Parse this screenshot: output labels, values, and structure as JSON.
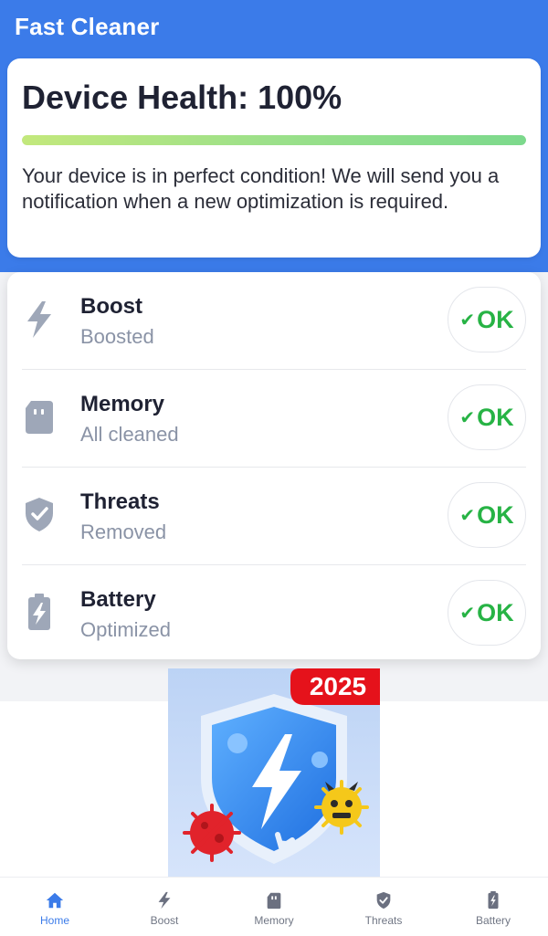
{
  "app": {
    "title": "Fast Cleaner"
  },
  "health": {
    "title": "Device Health: 100%",
    "progress": 1.0,
    "description": "Your device is in perfect condition! We will send you a notification when a new optimization is required."
  },
  "status": {
    "items": [
      {
        "icon": "bolt-icon",
        "title": "Boost",
        "subtitle": "Boosted",
        "button": "OK"
      },
      {
        "icon": "sd-card-icon",
        "title": "Memory",
        "subtitle": "All cleaned",
        "button": "OK"
      },
      {
        "icon": "shield-check-icon",
        "title": "Threats",
        "subtitle": "Removed",
        "button": "OK"
      },
      {
        "icon": "battery-icon",
        "title": "Battery",
        "subtitle": "Optimized",
        "button": "OK"
      }
    ]
  },
  "promo": {
    "badge": "2025"
  },
  "nav": {
    "items": [
      {
        "label": "Home",
        "active": true
      },
      {
        "label": "Boost",
        "active": false
      },
      {
        "label": "Memory",
        "active": false
      },
      {
        "label": "Threats",
        "active": false
      },
      {
        "label": "Battery",
        "active": false
      }
    ]
  },
  "colors": {
    "primary": "#3b7be9",
    "ok_green": "#27b345",
    "progress_start": "#c3e87c",
    "progress_end": "#7cd98c"
  }
}
